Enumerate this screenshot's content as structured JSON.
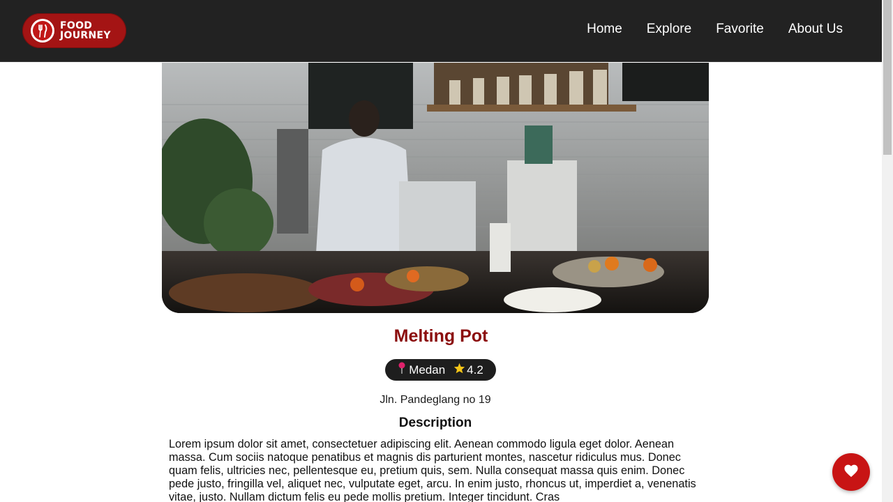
{
  "brand": {
    "line1": "FOOD",
    "line2": "JOURNEY"
  },
  "nav": [
    {
      "label": "Home"
    },
    {
      "label": "Explore"
    },
    {
      "label": "Favorite"
    },
    {
      "label": "About Us"
    }
  ],
  "restaurant": {
    "name": "Melting Pot",
    "city": "Medan",
    "rating": "4.2",
    "address": "Jln. Pandeglang no 19",
    "description_title": "Description",
    "description": "Lorem ipsum dolor sit amet, consectetuer adipiscing elit. Aenean commodo ligula eget dolor. Aenean massa. Cum sociis natoque penatibus et magnis dis parturient montes, nascetur ridiculus mus. Donec quam felis, ultricies nec, pellentesque eu, pretium quis, sem. Nulla consequat massa quis enim. Donec pede justo, fringilla vel, aliquet nec, vulputate eget, arcu. In enim justo, rhoncus ut, imperdiet a, venenatis vitae, justo. Nullam dictum felis eu pede mollis pretium. Integer tincidunt. Cras"
  },
  "colors": {
    "header_bg": "#222222",
    "brand_red": "#a41414",
    "title_red": "#8b0d0d",
    "fab_red": "#c81414"
  },
  "icons": {
    "logo": "fork-knife-icon",
    "location": "pin-icon",
    "rating": "star-icon",
    "favorite": "heart-icon"
  }
}
